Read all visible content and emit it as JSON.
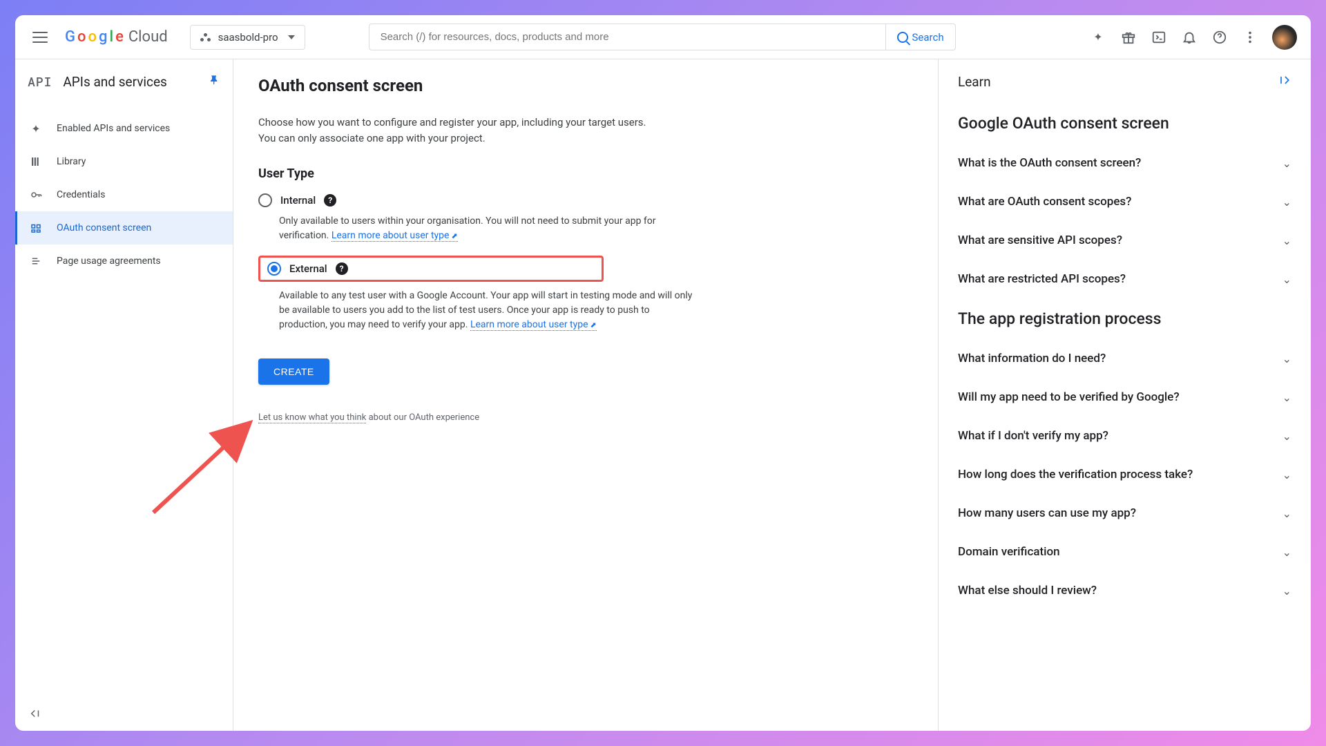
{
  "header": {
    "logo_cloud": "Cloud",
    "project_name": "saasbold-pro",
    "search_placeholder": "Search (/) for resources, docs, products and more",
    "search_button": "Search"
  },
  "sidebar": {
    "api_badge": "API",
    "title": "APIs and services",
    "items": [
      {
        "label": "Enabled APIs and services"
      },
      {
        "label": "Library"
      },
      {
        "label": "Credentials"
      },
      {
        "label": "OAuth consent screen"
      },
      {
        "label": "Page usage agreements"
      }
    ]
  },
  "main": {
    "page_title": "OAuth consent screen",
    "intro": "Choose how you want to configure and register your app, including your target users. You can only associate one app with your project.",
    "user_type_heading": "User Type",
    "internal": {
      "label": "Internal",
      "desc": "Only available to users within your organisation. You will not need to submit your app for verification. ",
      "link": "Learn more about user type"
    },
    "external": {
      "label": "External",
      "desc": "Available to any test user with a Google Account. Your app will start in testing mode and will only be available to users you add to the list of test users. Once your app is ready to push to production, you may need to verify your app. ",
      "link": "Learn more about user type"
    },
    "create_button": "CREATE",
    "feedback_link": "Let us know what you think",
    "feedback_rest": " about our OAuth experience"
  },
  "learn": {
    "title": "Learn",
    "section1": "Google OAuth consent screen",
    "items1": [
      "What is the OAuth consent screen?",
      "What are OAuth consent scopes?",
      "What are sensitive API scopes?",
      "What are restricted API scopes?"
    ],
    "section2": "The app registration process",
    "items2": [
      "What information do I need?",
      "Will my app need to be verified by Google?",
      "What if I don't verify my app?",
      "How long does the verification process take?",
      "How many users can use my app?",
      "Domain verification",
      "What else should I review?"
    ]
  }
}
